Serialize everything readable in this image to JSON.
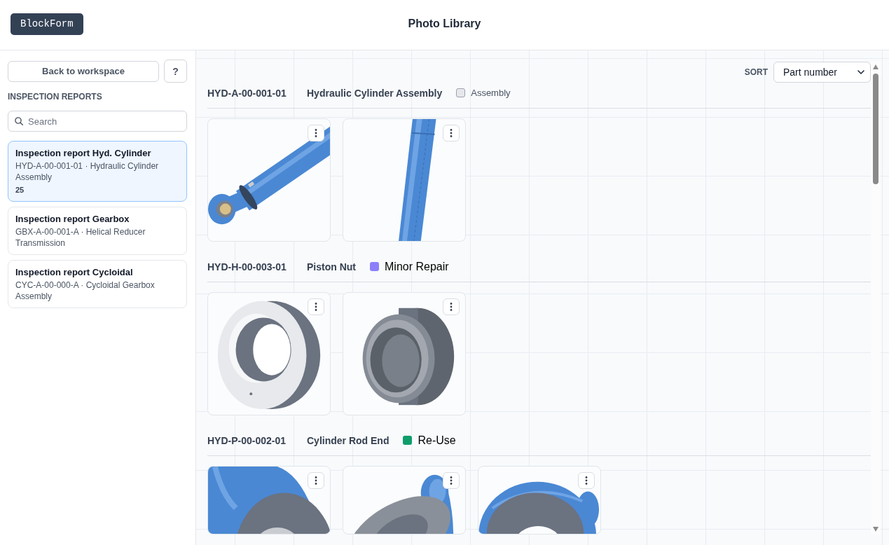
{
  "header": {
    "logo": "BlockForm",
    "title": "Photo Library"
  },
  "sidebar": {
    "back_button": "Back to workspace",
    "help_button": "?",
    "section_title": "INSPECTION REPORTS",
    "search": {
      "placeholder": "Search"
    },
    "reports": [
      {
        "title": "Inspection report Hyd. Cylinder",
        "subtitle": "HYD-A-00-001-01 · Hydraulic Cylinder Assembly",
        "count": "25",
        "selected": true
      },
      {
        "title": "Inspection report Gearbox",
        "subtitle": "GBX-A-00-001-A · Helical Reducer Transmission",
        "selected": false
      },
      {
        "title": "Inspection report Cycloidal",
        "subtitle": "CYC-A-00-000-A · Cycloidal Gearbox Assembly",
        "selected": false
      }
    ]
  },
  "main": {
    "sort": {
      "label": "SORT",
      "value": "Part number"
    },
    "groups": [
      {
        "part_number": "HYD-A-00-001-01",
        "name": "Hydraulic Cylinder Assembly",
        "status": {
          "kind": "type",
          "label": "Assembly",
          "color": "#e5e7eb"
        },
        "photos": [
          {
            "kind": "cylinder"
          },
          {
            "kind": "rod"
          }
        ]
      },
      {
        "part_number": "HYD-H-00-003-01",
        "name": "Piston Nut",
        "status": {
          "kind": "condition",
          "label": "Minor Repair",
          "color": "#8b80f9"
        },
        "photos": [
          {
            "kind": "ring"
          },
          {
            "kind": "bushing"
          }
        ]
      },
      {
        "part_number": "HYD-P-00-002-01",
        "name": "Cylinder Rod End",
        "status": {
          "kind": "condition",
          "label": "Re-Use",
          "color": "#0f9d6b"
        },
        "photos": [
          {
            "kind": "rod_end_front"
          },
          {
            "kind": "rod_end_tilted"
          },
          {
            "kind": "rod_end_top"
          }
        ]
      }
    ]
  }
}
